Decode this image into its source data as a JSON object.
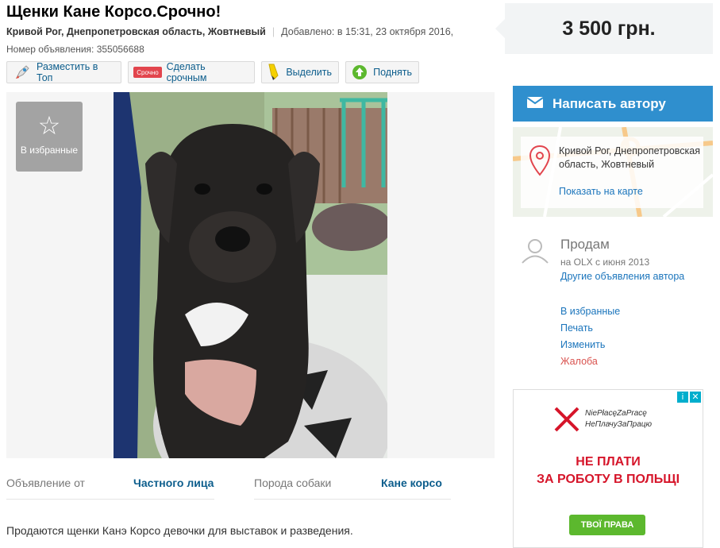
{
  "listing": {
    "title": "Щенки Кане Корсо.Срочно!",
    "location": "Кривой Рог, Днепропетровская область, Жовтневый",
    "added": "Добавлено: в 15:31, 23 октября 2016,",
    "ad_number": "Номер объявления: 355056688",
    "price": "3 500 грн."
  },
  "toolbar": {
    "top": "Разместить в Топ",
    "urgent": "Сделать срочным",
    "urgent_badge": "Срочно",
    "highlight": "Выделить",
    "up": "Поднять"
  },
  "gallery": {
    "favorite_label": "В избранные"
  },
  "params": [
    {
      "key": "Объявление от",
      "value": "Частного лица"
    },
    {
      "key": "Порода собаки",
      "value": "Кане корсо"
    }
  ],
  "description": "Продаются щенки Канэ Корсо девочки для выставок и разведения.",
  "sidebar": {
    "write_author": "Написать автору",
    "map_location": "Кривой Рог, Днепропетровская область, Жовтневый",
    "show_on_map": "Показать на карте",
    "seller_name": "Продам",
    "seller_since": "на OLX с июня 2013",
    "other_ads": "Другие объявления автора",
    "actions": {
      "favorite": "В избранные",
      "print": "Печать",
      "edit": "Изменить",
      "report": "Жалоба"
    }
  },
  "ad_banner": {
    "line1": "NiePłacęZaPracę",
    "line2": "НеПлачуЗаПрацю",
    "headline1": "НЕ ПЛАТИ",
    "headline2": "ЗА РОБОТУ В ПОЛЬЩІ",
    "button": "ТВОЇ ПРАВА",
    "info_icon": "i",
    "close_icon": "✕"
  },
  "colors": {
    "accent_blue": "#2f8fce",
    "link_blue": "#1b75bc",
    "report_red": "#d9534f"
  }
}
